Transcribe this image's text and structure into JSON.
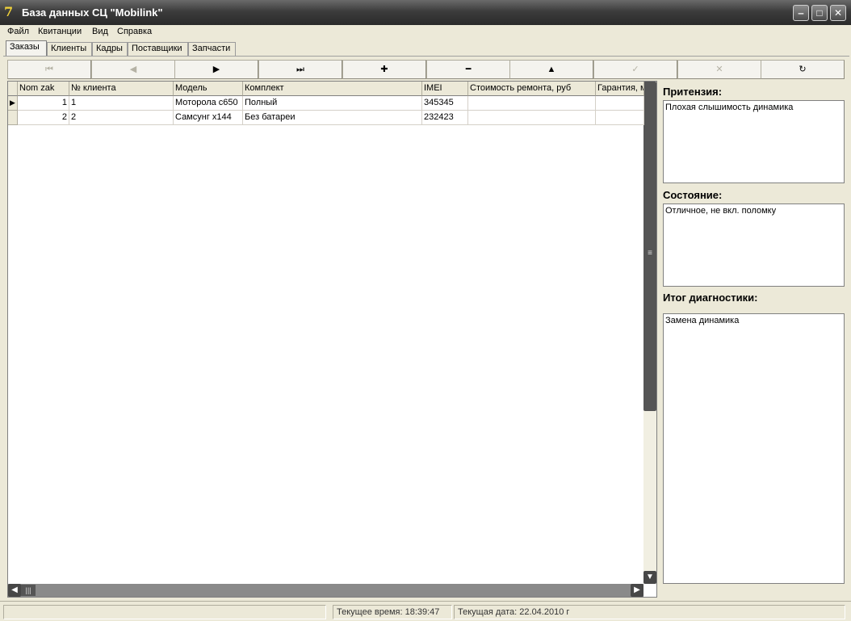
{
  "window": {
    "title": "База данных СЦ \"Mobilink\"",
    "icon": "7",
    "controls": {
      "minimize": "‒",
      "maximize": "□",
      "close": "✕"
    }
  },
  "menu": [
    "Файл",
    "Квитанции",
    "Вид",
    "Справка"
  ],
  "tabs": [
    "Заказы",
    "Клиенты",
    "Кадры",
    "Поставщики",
    "Запчасти"
  ],
  "active_tab": "Заказы",
  "navigator": [
    {
      "name": "first-record",
      "glyph": "⏮",
      "enabled": false
    },
    {
      "name": "prior-record",
      "glyph": "◀",
      "enabled": false
    },
    {
      "name": "next-record",
      "glyph": "▶",
      "enabled": true
    },
    {
      "name": "last-record",
      "glyph": "⏭",
      "enabled": true
    },
    {
      "name": "insert-record",
      "glyph": "✚",
      "enabled": true
    },
    {
      "name": "delete-record",
      "glyph": "━",
      "enabled": true
    },
    {
      "name": "edit-record",
      "glyph": "▲",
      "enabled": true
    },
    {
      "name": "post-edit",
      "glyph": "✓",
      "enabled": false
    },
    {
      "name": "cancel-edit",
      "glyph": "✕",
      "enabled": false
    },
    {
      "name": "refresh-data",
      "glyph": "↻",
      "enabled": true
    }
  ],
  "grid": {
    "columns": [
      "Nom zak",
      "№ клиента",
      "Модель",
      "Комплект",
      "IMEI",
      "Стоимость ремонта, руб",
      "Гарантия, м"
    ],
    "rows": [
      [
        "1",
        "1",
        "Моторола с650",
        "Полный",
        "345345",
        "",
        ""
      ],
      [
        "2",
        "2",
        "Самсунг х144",
        "Без батареи",
        "232423",
        "",
        ""
      ]
    ],
    "current_row": 0
  },
  "panels": {
    "claims": {
      "label": "Притензия:",
      "text": "Плохая слышимость динамика"
    },
    "condition": {
      "label": "Состояние:",
      "text": "Отличное, не вкл. поломку"
    },
    "diagnostics": {
      "label": "Итог диагностики:",
      "text": "Замена динамика"
    }
  },
  "status": {
    "time": "Текущее время: 18:39:47",
    "date": "Текущая дата: 22.04.2010 г"
  }
}
